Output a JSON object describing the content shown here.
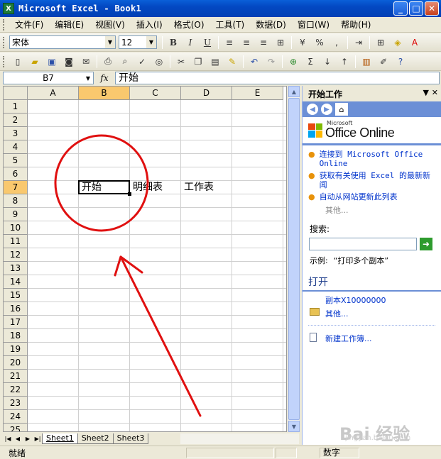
{
  "window": {
    "title": "Microsoft Excel - Book1",
    "app_icon_glyph": "X",
    "buttons": [
      "_",
      "□",
      "✕"
    ]
  },
  "menu": [
    "文件(F)",
    "编辑(E)",
    "视图(V)",
    "插入(I)",
    "格式(O)",
    "工具(T)",
    "数据(D)",
    "窗口(W)",
    "帮助(H)"
  ],
  "format_toolbar": {
    "font": "宋体",
    "size": "12",
    "bold": "B",
    "italic": "I",
    "underline": "U",
    "percent": "%",
    "comma": ","
  },
  "standard_toolbar": {
    "sum": "Σ",
    "zoom_glyph": "?"
  },
  "formula_bar": {
    "name_box": "B7",
    "fx": "fx",
    "content": "开始"
  },
  "sheet": {
    "columns": [
      "A",
      "B",
      "C",
      "D",
      "E"
    ],
    "active_column": "B",
    "rows": [
      "1",
      "2",
      "3",
      "4",
      "5",
      "6",
      "7",
      "8",
      "9",
      "10",
      "11",
      "12",
      "13",
      "14",
      "15",
      "16",
      "17",
      "18",
      "19",
      "20",
      "21",
      "22",
      "23",
      "24",
      "25"
    ],
    "active_row": "7",
    "cells": {
      "B7": "开始",
      "C7": "明细表",
      "D7": "工作表"
    }
  },
  "sheet_tabs": [
    "Sheet1",
    "Sheet2",
    "Sheet3"
  ],
  "active_sheet": "Sheet1",
  "status": {
    "left": "就绪",
    "num": "数字"
  },
  "taskpane": {
    "title": "开始工作",
    "logo_small": "Microsoft",
    "logo_text": "Office Online",
    "links": [
      "连接到 Microsoft Office Online",
      "获取有关使用 Excel 的最新新闻",
      "自动从网站更新此列表"
    ],
    "more": "其他...",
    "search_label": "搜索:",
    "example_label": "示例:",
    "example_text": "“打印多个副本”",
    "open_section": "打开",
    "open_items": [
      "副本X10000000",
      "其他..."
    ],
    "new_workbook": "新建工作簿..."
  },
  "watermark": {
    "text": "Bai 经验",
    "url": "jingyan.baidu.com"
  },
  "annotation_color": "#E01010"
}
